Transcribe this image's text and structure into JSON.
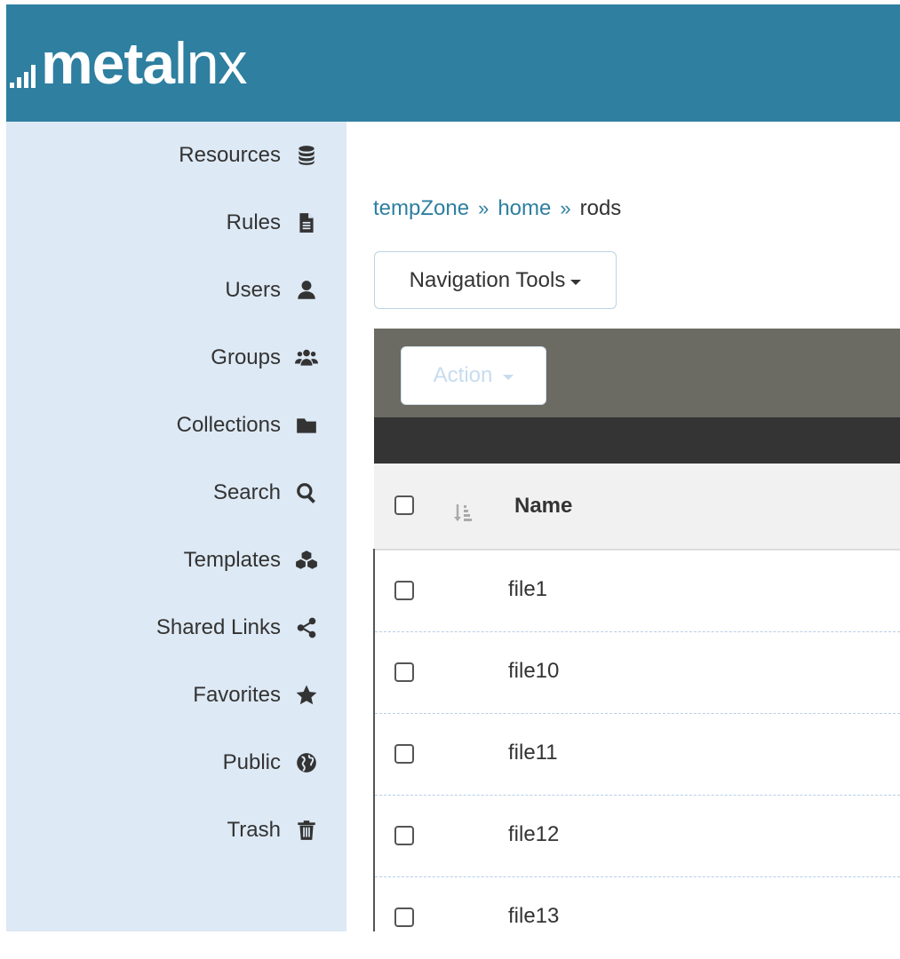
{
  "app": {
    "logo_text_bold": "meta",
    "logo_text_light": "lnx",
    "brand_color": "#2e7fa0"
  },
  "sidebar": {
    "items": [
      {
        "label": "Resources",
        "icon": "database-icon"
      },
      {
        "label": "Rules",
        "icon": "file-icon"
      },
      {
        "label": "Users",
        "icon": "user-icon"
      },
      {
        "label": "Groups",
        "icon": "users-group-icon"
      },
      {
        "label": "Collections",
        "icon": "folder-icon"
      },
      {
        "label": "Search",
        "icon": "search-icon"
      },
      {
        "label": "Templates",
        "icon": "cubes-icon"
      },
      {
        "label": "Shared Links",
        "icon": "share-icon"
      },
      {
        "label": "Favorites",
        "icon": "star-icon"
      },
      {
        "label": "Public",
        "icon": "globe-icon"
      },
      {
        "label": "Trash",
        "icon": "trash-icon"
      }
    ]
  },
  "breadcrumb": {
    "items": [
      "tempZone",
      "home",
      "rods"
    ],
    "separator": "»"
  },
  "toolbar": {
    "navigation_tools_label": "Navigation Tools",
    "action_label": "Action"
  },
  "table": {
    "columns": [
      "Name"
    ],
    "rows": [
      {
        "name": "file1"
      },
      {
        "name": "file10"
      },
      {
        "name": "file11"
      },
      {
        "name": "file12"
      },
      {
        "name": "file13"
      }
    ]
  }
}
